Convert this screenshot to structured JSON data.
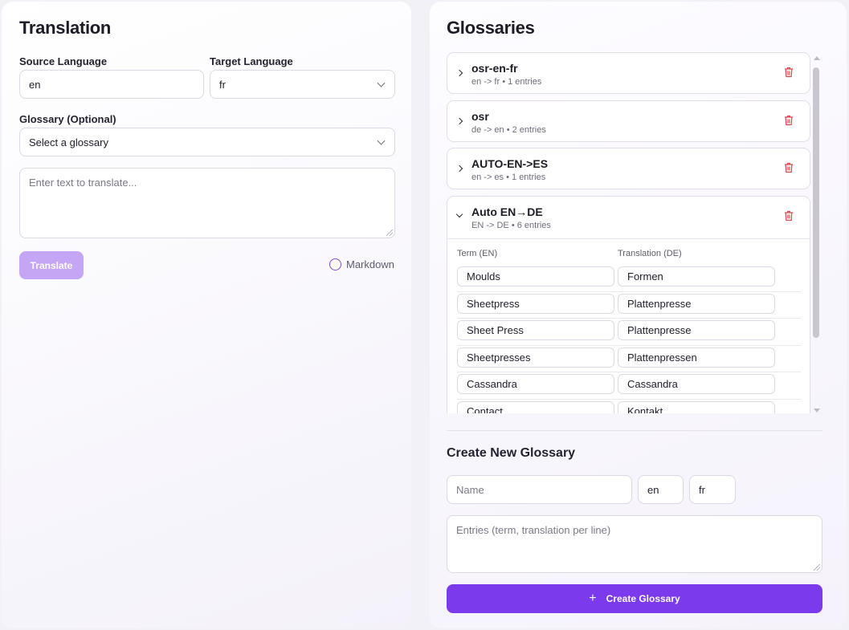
{
  "translation": {
    "title": "Translation",
    "source_label": "Source Language",
    "source_value": "en",
    "target_label": "Target Language",
    "target_value": "fr",
    "glossary_label": "Glossary (Optional)",
    "glossary_placeholder": "Select a glossary",
    "text_placeholder": "Enter text to translate...",
    "translate_label": "Translate",
    "markdown_label": "Markdown"
  },
  "glossaries": {
    "title": "Glossaries",
    "items": [
      {
        "name": "osr-en-fr",
        "meta": "en -> fr • 1 entries",
        "expanded": false
      },
      {
        "name": "osr",
        "meta": "de -> en • 2 entries",
        "expanded": false
      },
      {
        "name": "AUTO-EN->ES",
        "meta": "en -> es • 1 entries",
        "expanded": false
      },
      {
        "name": "Auto EN→DE",
        "meta": "EN -> DE • 6 entries",
        "expanded": true
      }
    ],
    "expanded": {
      "term_header": "Term (EN)",
      "translation_header": "Translation (DE)",
      "entries": [
        {
          "term": "Moulds",
          "translation": "Formen"
        },
        {
          "term": "Sheetpress",
          "translation": "Plattenpresse"
        },
        {
          "term": "Sheet Press",
          "translation": "Plattenpresse"
        },
        {
          "term": "Sheetpresses",
          "translation": "Plattenpressen"
        },
        {
          "term": "Cassandra",
          "translation": "Cassandra"
        },
        {
          "term": "Contact",
          "translation": "Kontakt"
        }
      ]
    }
  },
  "create": {
    "title": "Create New Glossary",
    "name_placeholder": "Name",
    "source_value": "en",
    "target_value": "fr",
    "entries_placeholder": "Entries (term, translation per line)",
    "button_label": "Create Glossary",
    "button_icon": "plus-icon"
  },
  "colors": {
    "accent": "#7c3aed",
    "accent_disabled": "#c4a6f5",
    "danger": "#e0474c"
  }
}
